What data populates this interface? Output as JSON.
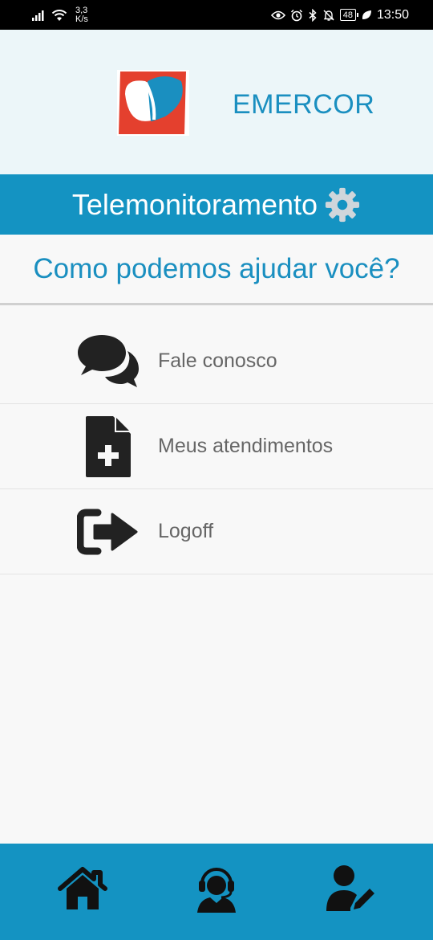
{
  "status_bar": {
    "net_speed_value": "3,3",
    "net_speed_unit": "K/s",
    "battery": "48",
    "time": "13:50"
  },
  "header": {
    "brand": "EMERCOR",
    "logo_colors": {
      "primary": "#e4402e",
      "secondary": "#1a8fc0"
    }
  },
  "title_bar": {
    "title": "Telemonitoramento",
    "settings_icon": "gear-icon"
  },
  "help": {
    "heading": "Como podemos ajudar você?"
  },
  "menu": {
    "items": [
      {
        "label": "Fale conosco",
        "icon": "chat-bubbles-icon"
      },
      {
        "label": "Meus atendimentos",
        "icon": "file-add-icon"
      },
      {
        "label": "Logoff",
        "icon": "logout-icon"
      }
    ]
  },
  "bottom_nav": {
    "items": [
      {
        "icon": "home-icon"
      },
      {
        "icon": "headset-support-icon"
      },
      {
        "icon": "user-edit-icon"
      }
    ]
  },
  "colors": {
    "accent": "#1493c2",
    "header_bg": "#ecf6f9",
    "text_blue": "#1a8fc0",
    "menu_text": "#666666"
  }
}
